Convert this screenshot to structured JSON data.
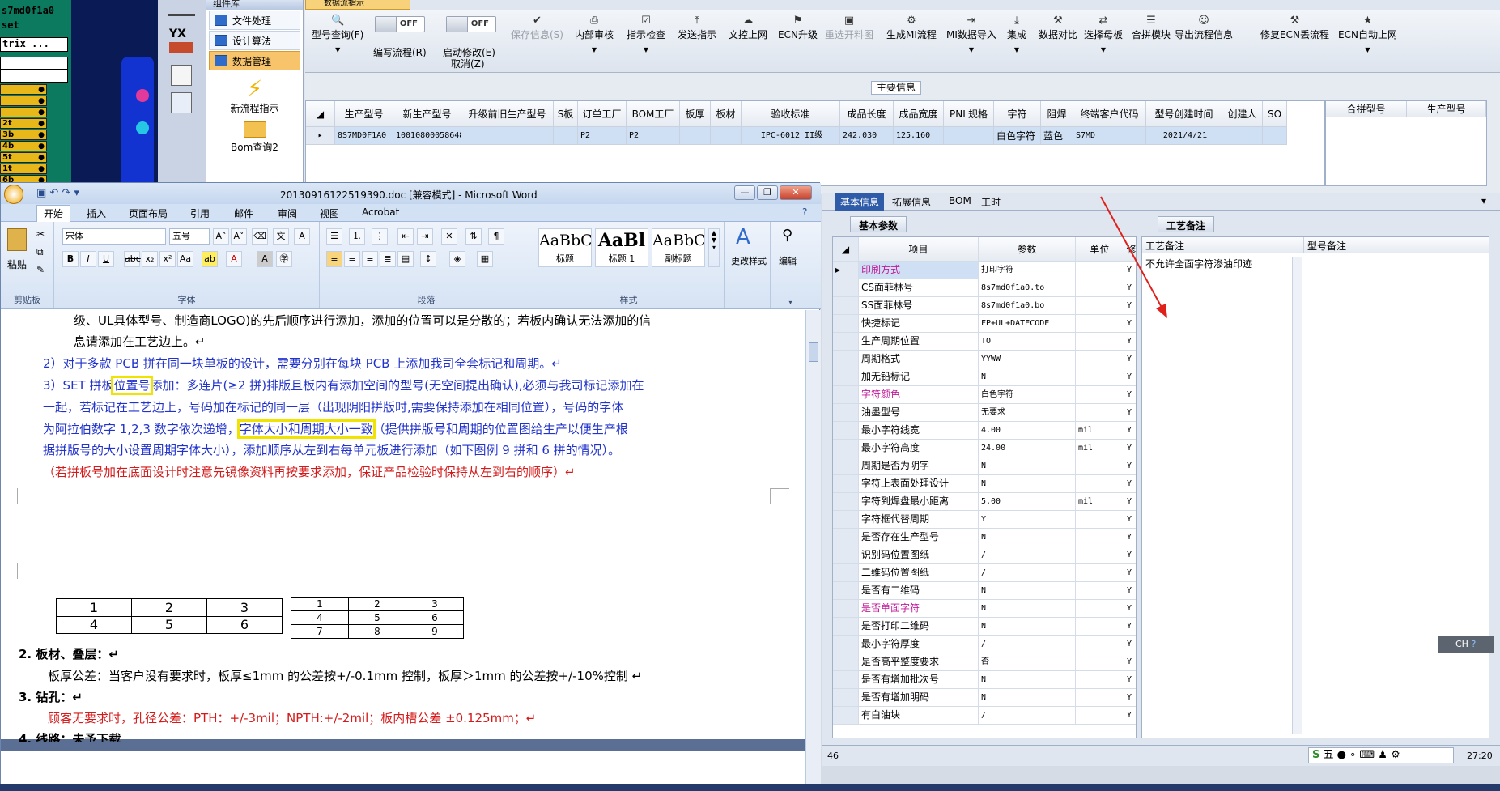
{
  "left_strip": {
    "rows": [
      "s7md0f1a0",
      "set",
      "trix ..."
    ],
    "layers": [
      "2t",
      "3b",
      "4b",
      "5t",
      "1t",
      "6b",
      "1b"
    ]
  },
  "app": {
    "nav_header": "组件库",
    "nav_items": [
      "文件处理",
      "设计算法",
      "数据管理"
    ],
    "nav_big": [
      "新流程指示",
      "Bom查询2"
    ],
    "doc_tab": "数据流指示",
    "icon_logo": "YX",
    "toolbar": {
      "query": "型号查询(F)",
      "toggle1_state": "OFF",
      "toggle1_label": "编写流程(R)",
      "toggle2_state": "OFF",
      "toggle2_label": "启动修改(E)",
      "cancel": "取消(Z)",
      "save": "保存信息(S)",
      "buttons": [
        "内部审核",
        "指示检查",
        "发送指示",
        "文控上网",
        "ECN升级",
        "重选开料图",
        "生成MI流程",
        "MI数据导入",
        "集成",
        "数据对比",
        "选择母板",
        "合拼模块",
        "导出流程信息",
        "修复ECN丢流程",
        "ECN自动上网"
      ]
    },
    "main_info_label": "主要信息",
    "grid": {
      "headers": [
        "生产型号",
        "新生产型号",
        "升级前旧生产型号",
        "S板",
        "订单工厂",
        "BOM工厂",
        "板厚",
        "板材",
        "验收标准",
        "成品长度",
        "成品宽度",
        "PNL规格",
        "字符",
        "阻焊",
        "终端客户代码",
        "型号创建时间",
        "创建人",
        "SO"
      ],
      "row": [
        "8S7MD0F1A0",
        "10010800058648",
        "",
        "",
        "P2",
        "P2",
        "",
        "",
        "IPC-6012 II级",
        "242.030",
        "125.160",
        "",
        "白色字符",
        "蓝色",
        "S7MD",
        "2021/4/21",
        "",
        ""
      ]
    },
    "grid2_headers": [
      "合拼型号",
      "生产型号"
    ]
  },
  "word": {
    "title": "20130916122519390.doc [兼容模式] - Microsoft Word",
    "tabs": [
      "开始",
      "插入",
      "页面布局",
      "引用",
      "邮件",
      "审阅",
      "视图",
      "Acrobat"
    ],
    "font_name": "宋体",
    "font_size": "五号",
    "groups": [
      "剪贴板",
      "字体",
      "段落",
      "样式",
      "编辑"
    ],
    "paste": "粘贴",
    "styles": [
      {
        "sample": "AaBbC",
        "name": "标题"
      },
      {
        "sample": "AaBl",
        "name": "标题 1"
      },
      {
        "sample": "AaBbC",
        "name": "副标题"
      }
    ],
    "change_styles": "更改样式",
    "edit": "编辑",
    "lines": {
      "l1": "级、UL具体型号、制造商LOGO)的先后顺序进行添加，添加的位置可以是分散的；若板内确认无法添加的信",
      "l2": "息请添加在工艺边上。↵",
      "l3": "2）对于多款 PCB 拼在同一块单板的设计，需要分别在每块 PCB 上添加我司全套标记和周期。↵",
      "l4a": "3）SET 拼板",
      "l4b": "位置号",
      "l4c": "添加：多连片(≥2 拼)排版且板内有添加空间的型号(无空间提出确认),必须与我司标记添加在",
      "l5": "一起，若标记在工艺边上，号码加在标记的同一层（出现阴阳拼版时,需要保持添加在相同位置），号码的字体",
      "l6a": "为阿拉伯数字  1,2,3  数字依次递增，",
      "l6b": "字体大小和周期大小一致",
      "l6c": "（提供拼版号和周期的位置图给生产以便生产根",
      "l7": "据拼版号的大小设置周期字体大小），添加顺序从左到右每单元板进行添加（如下图例 9 拼和 6 拼的情况）。",
      "l8": "（若拼板号加在底面设计时注意先镜像资料再按要求添加，保证产品检验时保持从左到右的顺序）↵",
      "s2": "2.    板材、叠层：↵",
      "s2body": "板厚公差：当客户没有要求时，板厚≤1mm 的公差按+/-0.1mm 控制，板厚＞1mm 的公差按+/-10%控制      ↵",
      "s3": "3.    钻孔：↵",
      "s3body": "顾客无要求时，孔径公差：PTH：+/-3mil；NPTH:+/-2mil；板内槽公差  ±0.125mm；↵",
      "s4": "4.    线路：未予下载"
    },
    "table6": [
      [
        "1",
        "2",
        "3"
      ],
      [
        "4",
        "5",
        "6"
      ]
    ],
    "table9": [
      [
        "1",
        "2",
        "3"
      ],
      [
        "4",
        "5",
        "6"
      ],
      [
        "7",
        "8",
        "9"
      ]
    ]
  },
  "right": {
    "tabs": [
      "基本信息",
      "拓展信息",
      "BOM",
      "工时"
    ],
    "sect_basic": "基本参数",
    "sect_proc": "工艺备注",
    "pgrid_headers": [
      "项目",
      "参数",
      "单位",
      "修改"
    ],
    "params": [
      {
        "item": "印刷方式",
        "val": "打印字符",
        "unit": "",
        "mod": "Y",
        "pink": true
      },
      {
        "item": "CS面菲林号",
        "val": "8s7md0f1a0.to",
        "unit": "",
        "mod": "Y"
      },
      {
        "item": "SS面菲林号",
        "val": "8s7md0f1a0.bo",
        "unit": "",
        "mod": "Y"
      },
      {
        "item": "快捷标记",
        "val": "FP+UL+DATECODE",
        "unit": "",
        "mod": "Y"
      },
      {
        "item": "生产周期位置",
        "val": "TO",
        "unit": "",
        "mod": "Y"
      },
      {
        "item": "周期格式",
        "val": "YYWW",
        "unit": "",
        "mod": "Y"
      },
      {
        "item": "加无铅标记",
        "val": "N",
        "unit": "",
        "mod": "Y"
      },
      {
        "item": "字符颜色",
        "val": "白色字符",
        "unit": "",
        "mod": "Y",
        "pink": true
      },
      {
        "item": "油墨型号",
        "val": "无要求",
        "unit": "",
        "mod": "Y"
      },
      {
        "item": "最小字符线宽",
        "val": "4.00",
        "unit": "mil",
        "mod": "Y"
      },
      {
        "item": "最小字符高度",
        "val": "24.00",
        "unit": "mil",
        "mod": "Y"
      },
      {
        "item": "周期是否为阴字",
        "val": "N",
        "unit": "",
        "mod": "Y"
      },
      {
        "item": "字符上表面处理设计",
        "val": "N",
        "unit": "",
        "mod": "Y"
      },
      {
        "item": "字符到焊盘最小距离",
        "val": "5.00",
        "unit": "mil",
        "mod": "Y"
      },
      {
        "item": "字符框代替周期",
        "val": "Y",
        "unit": "",
        "mod": "Y"
      },
      {
        "item": "是否存在生产型号",
        "val": "N",
        "unit": "",
        "mod": "Y"
      },
      {
        "item": "识别码位置图纸",
        "val": "/",
        "unit": "",
        "mod": "Y"
      },
      {
        "item": "二维码位置图纸",
        "val": "/",
        "unit": "",
        "mod": "Y"
      },
      {
        "item": "是否有二维码",
        "val": "N",
        "unit": "",
        "mod": "Y"
      },
      {
        "item": "是否单面字符",
        "val": "N",
        "unit": "",
        "mod": "Y",
        "pink": true
      },
      {
        "item": "是否打印二维码",
        "val": "N",
        "unit": "",
        "mod": "Y"
      },
      {
        "item": "最小字符厚度",
        "val": "/",
        "unit": "",
        "mod": "Y"
      },
      {
        "item": "是否高平整度要求",
        "val": "否",
        "unit": "",
        "mod": "Y"
      },
      {
        "item": "是否有增加批次号",
        "val": "N",
        "unit": "",
        "mod": "Y"
      },
      {
        "item": "是否有增加明码",
        "val": "N",
        "unit": "",
        "mod": "Y"
      },
      {
        "item": "有白油块",
        "val": "/",
        "unit": "",
        "mod": "Y"
      }
    ],
    "notes_headers": [
      "工艺备注",
      "型号备注"
    ],
    "note_text": "不允许全面字符渗油印迹",
    "status_left": "46",
    "ime": "CH",
    "clock": "27:20",
    "ime_bar": "五"
  }
}
